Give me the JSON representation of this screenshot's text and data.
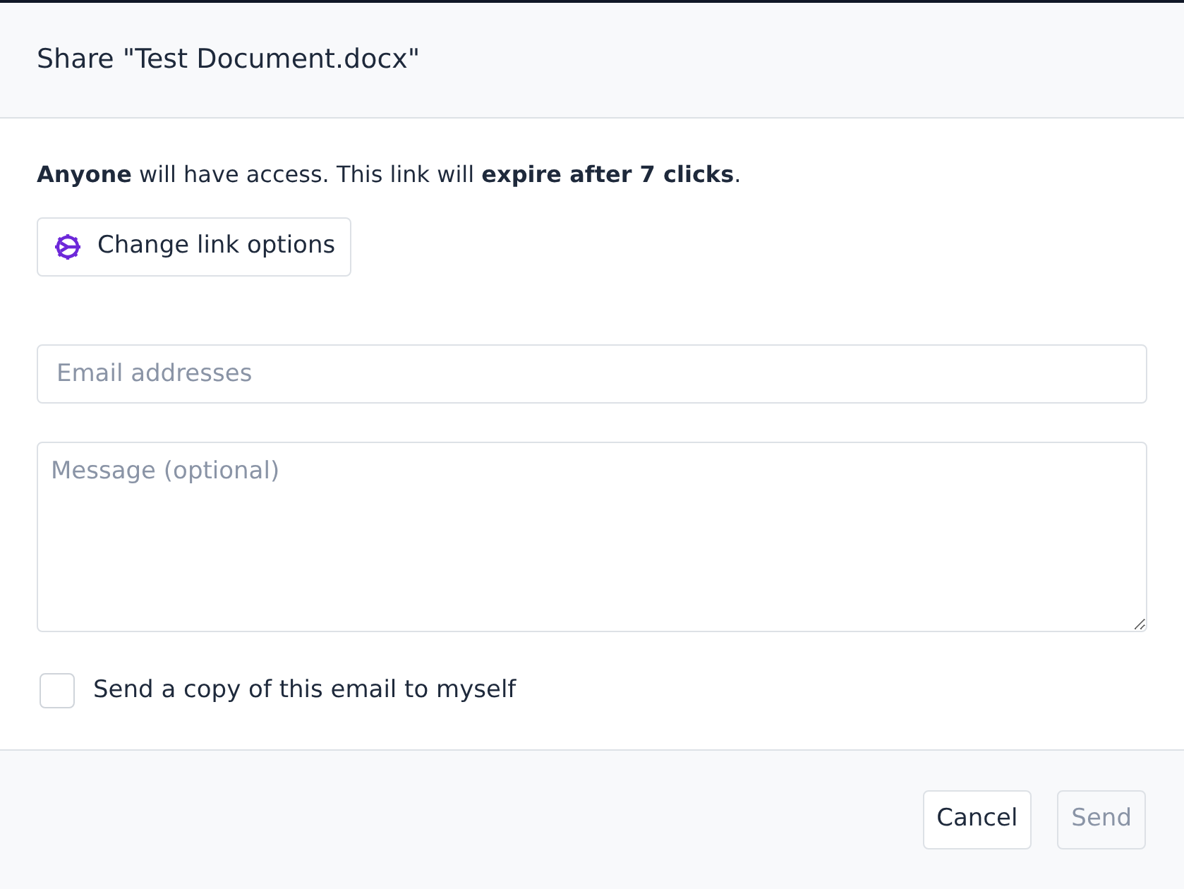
{
  "dialog": {
    "title": "Share \"Test Document.docx\""
  },
  "access_note": "**Anyone** will have access. This link will **expire after 7 clicks**.",
  "link_options_button": {
    "label": "Change link options"
  },
  "email_field": {
    "placeholder": "Email addresses"
  },
  "message_field": {
    "placeholder": "Message (optional)"
  },
  "copy_checkbox": {
    "label": "Send a copy of this email to myself",
    "checked": false
  },
  "buttons": [
    {
      "label": "Cancel",
      "disabled": false
    },
    {
      "label": "Send",
      "disabled": true
    }
  ]
}
